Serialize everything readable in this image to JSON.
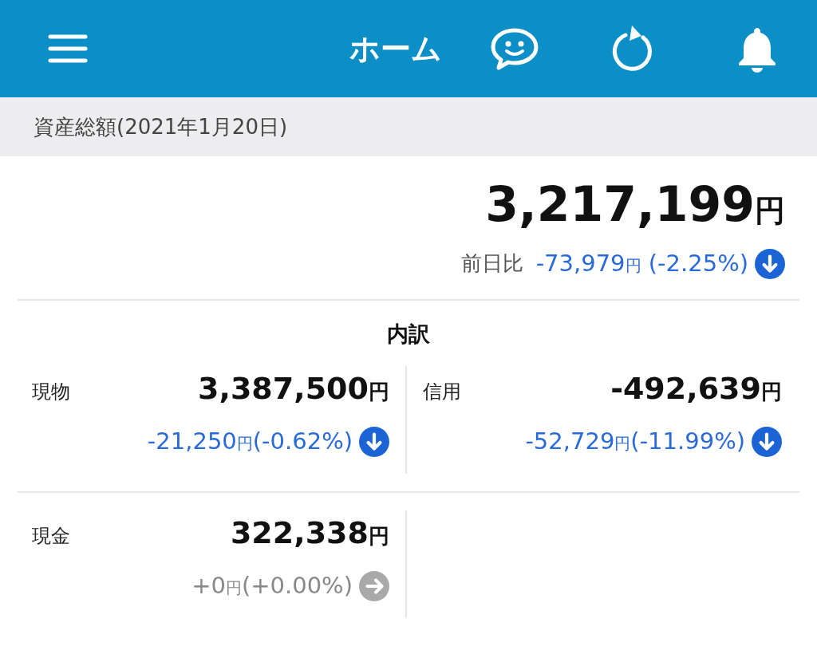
{
  "header": {
    "title": "ホーム"
  },
  "summary": {
    "label": "資産総額(2021年1月20日)",
    "total": "3,217,199",
    "unit": "円",
    "change_label": "前日比",
    "change": "-73,979",
    "change_unit": "円",
    "change_pct": "(-2.25%)",
    "kind": "down"
  },
  "breakdown": {
    "title": "内訳",
    "items": [
      {
        "label": "現物",
        "amount": "3,387,500",
        "unit": "円",
        "change": "-21,250",
        "change_unit": "円",
        "change_pct": "(-0.62%)",
        "kind": "down"
      },
      {
        "label": "信用",
        "amount": "-492,639",
        "unit": "円",
        "change": "-52,729",
        "change_unit": "円",
        "change_pct": "(-11.99%)",
        "kind": "down"
      },
      {
        "label": "現金",
        "amount": "322,338",
        "unit": "円",
        "change": "+0",
        "change_unit": "円",
        "change_pct": "(+0.00%)",
        "kind": "flat"
      }
    ]
  }
}
